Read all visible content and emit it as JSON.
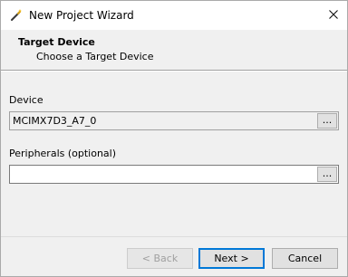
{
  "window": {
    "title": "New Project Wizard",
    "close_glyph": "✕"
  },
  "header": {
    "title": "Target Device",
    "subtitle": "Choose a Target Device"
  },
  "device": {
    "label": "Device",
    "value": "MCIMX7D3_A7_0",
    "browse_label": "..."
  },
  "peripherals": {
    "label": "Peripherals (optional)",
    "value": "",
    "browse_label": "..."
  },
  "buttons": {
    "back": "< Back",
    "next": "Next >",
    "cancel": "Cancel"
  },
  "icons": {
    "title": "wand-icon",
    "close": "close-icon"
  }
}
